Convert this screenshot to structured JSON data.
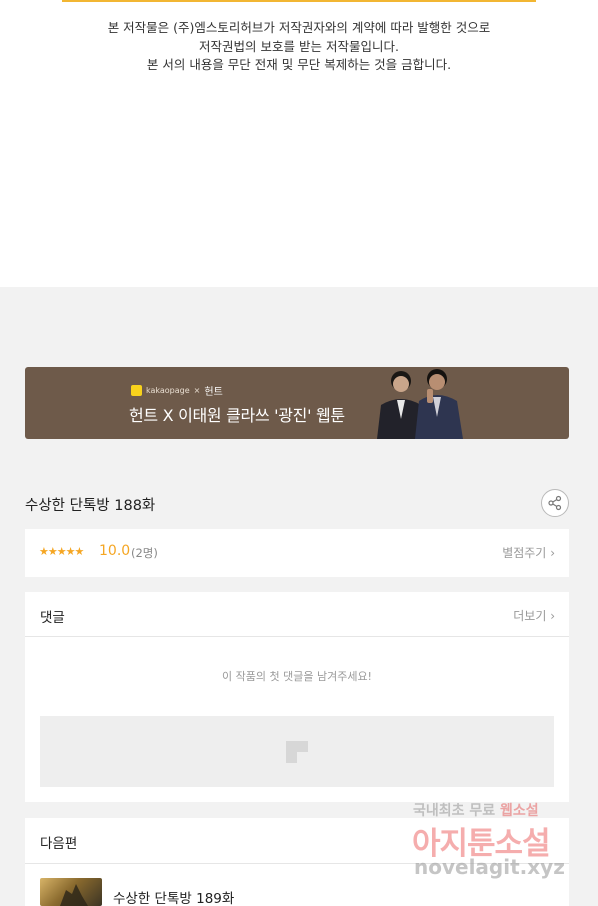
{
  "notice": {
    "lines": [
      "본 저작물은 (주)엠스토리허브가 저작권자와의 계약에 따라 발행한 것으로",
      "저작권법의 보호를 받는 저작물입니다.",
      "본 서의 내용을 무단 전재 및 무단 복제하는 것을 금합니다."
    ]
  },
  "banner": {
    "brand": "kakaopage",
    "separator": "×",
    "partner": "헌트",
    "title": "헌트 X 이태원 클라쓰 '광진' 웹툰",
    "background": "#6e5a4a"
  },
  "episode": {
    "title": "수상한 단톡방 188화",
    "share_icon": "share-icon"
  },
  "rating": {
    "stars": "★★★★★",
    "score": "10.0",
    "count": "(2명)",
    "action": "별점주기",
    "accent": "#f5a623"
  },
  "comments": {
    "title": "댓글",
    "more": "더보기",
    "empty": "이 작품의 첫 댓글을 남겨주세요!"
  },
  "next": {
    "title": "다음편",
    "episode": "수상한 단톡방 189화"
  },
  "watermark": {
    "line1": "국내최초 무료",
    "line1_highlight": "웹소설",
    "line2": "아지툰소설",
    "line3": "novelagit.xyz"
  }
}
